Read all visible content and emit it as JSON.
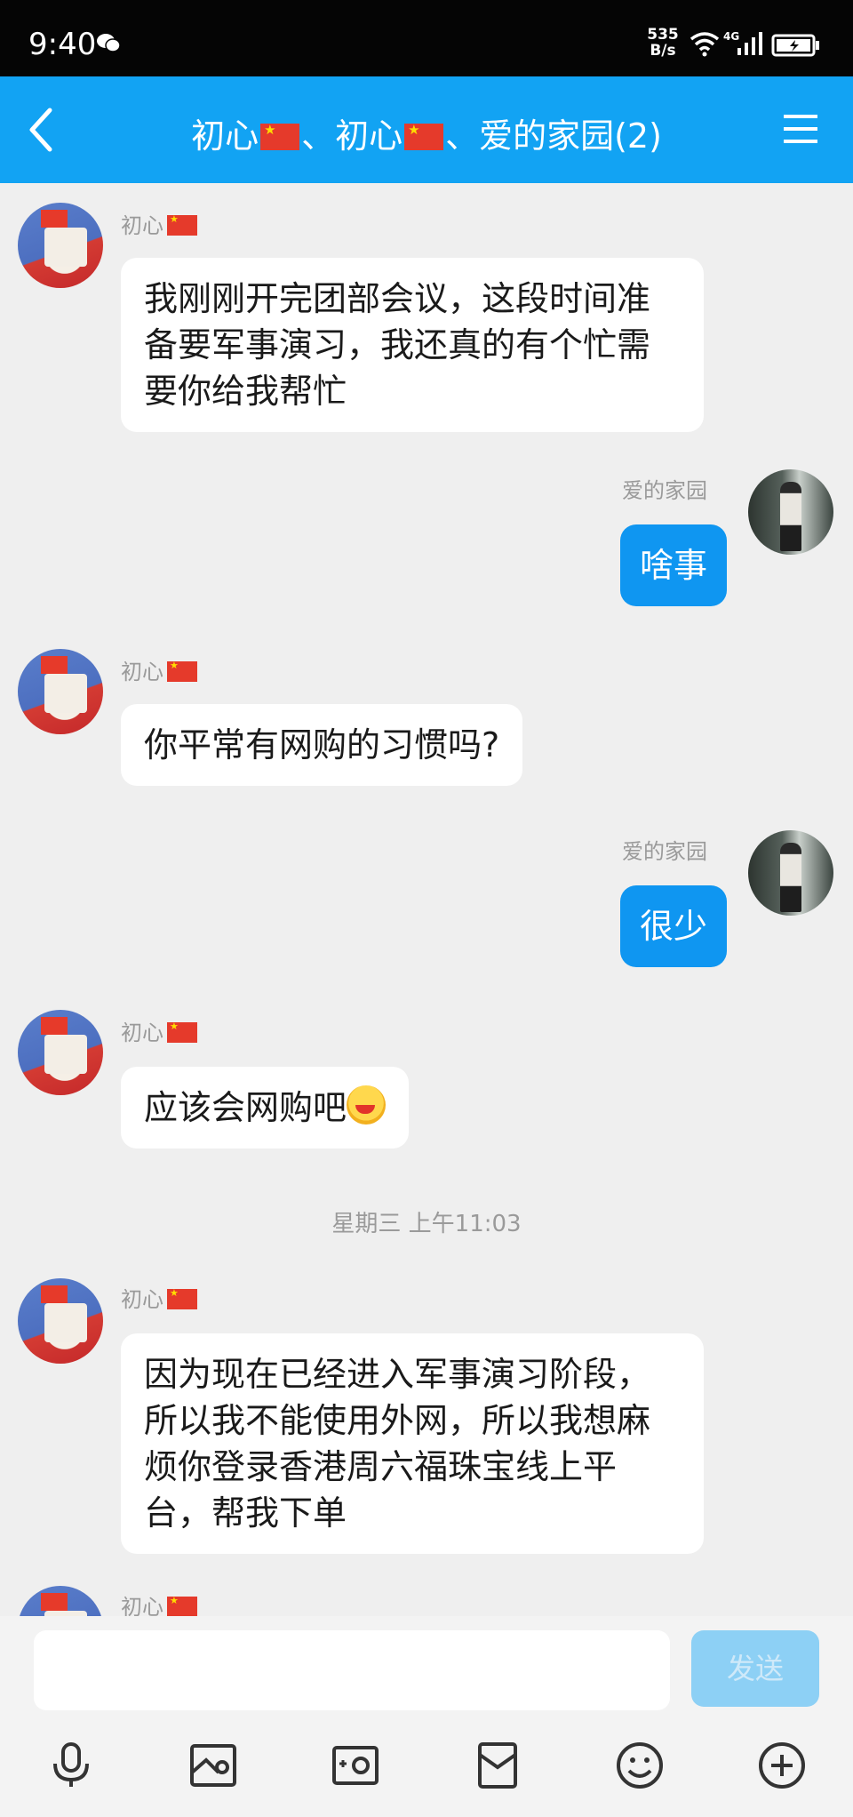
{
  "status_bar": {
    "time": "9:40",
    "net_speed_value": "535",
    "net_speed_unit": "B/s",
    "network_type": "4G"
  },
  "header": {
    "title_part1": "初心",
    "title_sep1": "、初心",
    "title_sep2": "、爱的家园(2)"
  },
  "messages": [
    {
      "sender": "初心",
      "text_lines": [
        "我刚刚开完团部会议，这段时间准",
        "备要军事演习，我还真的有个忙需",
        "要你给我帮忙"
      ]
    },
    {
      "sender": "爱的家园",
      "text": "啥事"
    },
    {
      "sender": "初心",
      "text": "你平常有网购的习惯吗?"
    },
    {
      "sender": "爱的家园",
      "text": "很少"
    },
    {
      "sender": "初心",
      "text": "应该会网购吧"
    },
    {
      "sender": "初心",
      "text_lines": [
        "因为现在已经进入军事演习阶段，",
        "所以我不能使用外网，所以我想麻",
        "烦你登录香港周六福珠宝线上平",
        "台，帮我下单"
      ]
    },
    {
      "sender": "初心"
    }
  ],
  "timestamp": "星期三 上午11:03",
  "input": {
    "placeholder": "",
    "send_label": "发送"
  },
  "colors": {
    "header_bg": "#12a3f3",
    "outgoing_bubble": "#0f96f1",
    "send_button": "#8dd0f5"
  }
}
